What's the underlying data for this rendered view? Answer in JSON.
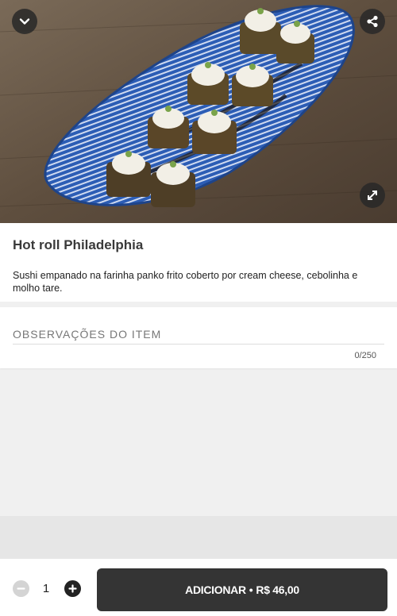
{
  "product": {
    "name": "Hot roll Philadelphia",
    "description": "Sushi empanado na farinha panko frito coberto por cream cheese, cebolinha e molho tare."
  },
  "hero": {
    "collapse_icon": "chevron-down-icon",
    "share_icon": "share-icon",
    "expand_icon": "expand-icon"
  },
  "notes": {
    "placeholder": "OBSERVAÇÕES DO ITEM",
    "value": "",
    "counter": "0/250"
  },
  "order": {
    "quantity": "1",
    "add_label": "ADICIONAR",
    "separator": "•",
    "price": "R$ 46,00"
  },
  "colors": {
    "button_dark": "#343434",
    "plate_blue": "#2a5ab0",
    "background": "#f0f0f0"
  }
}
